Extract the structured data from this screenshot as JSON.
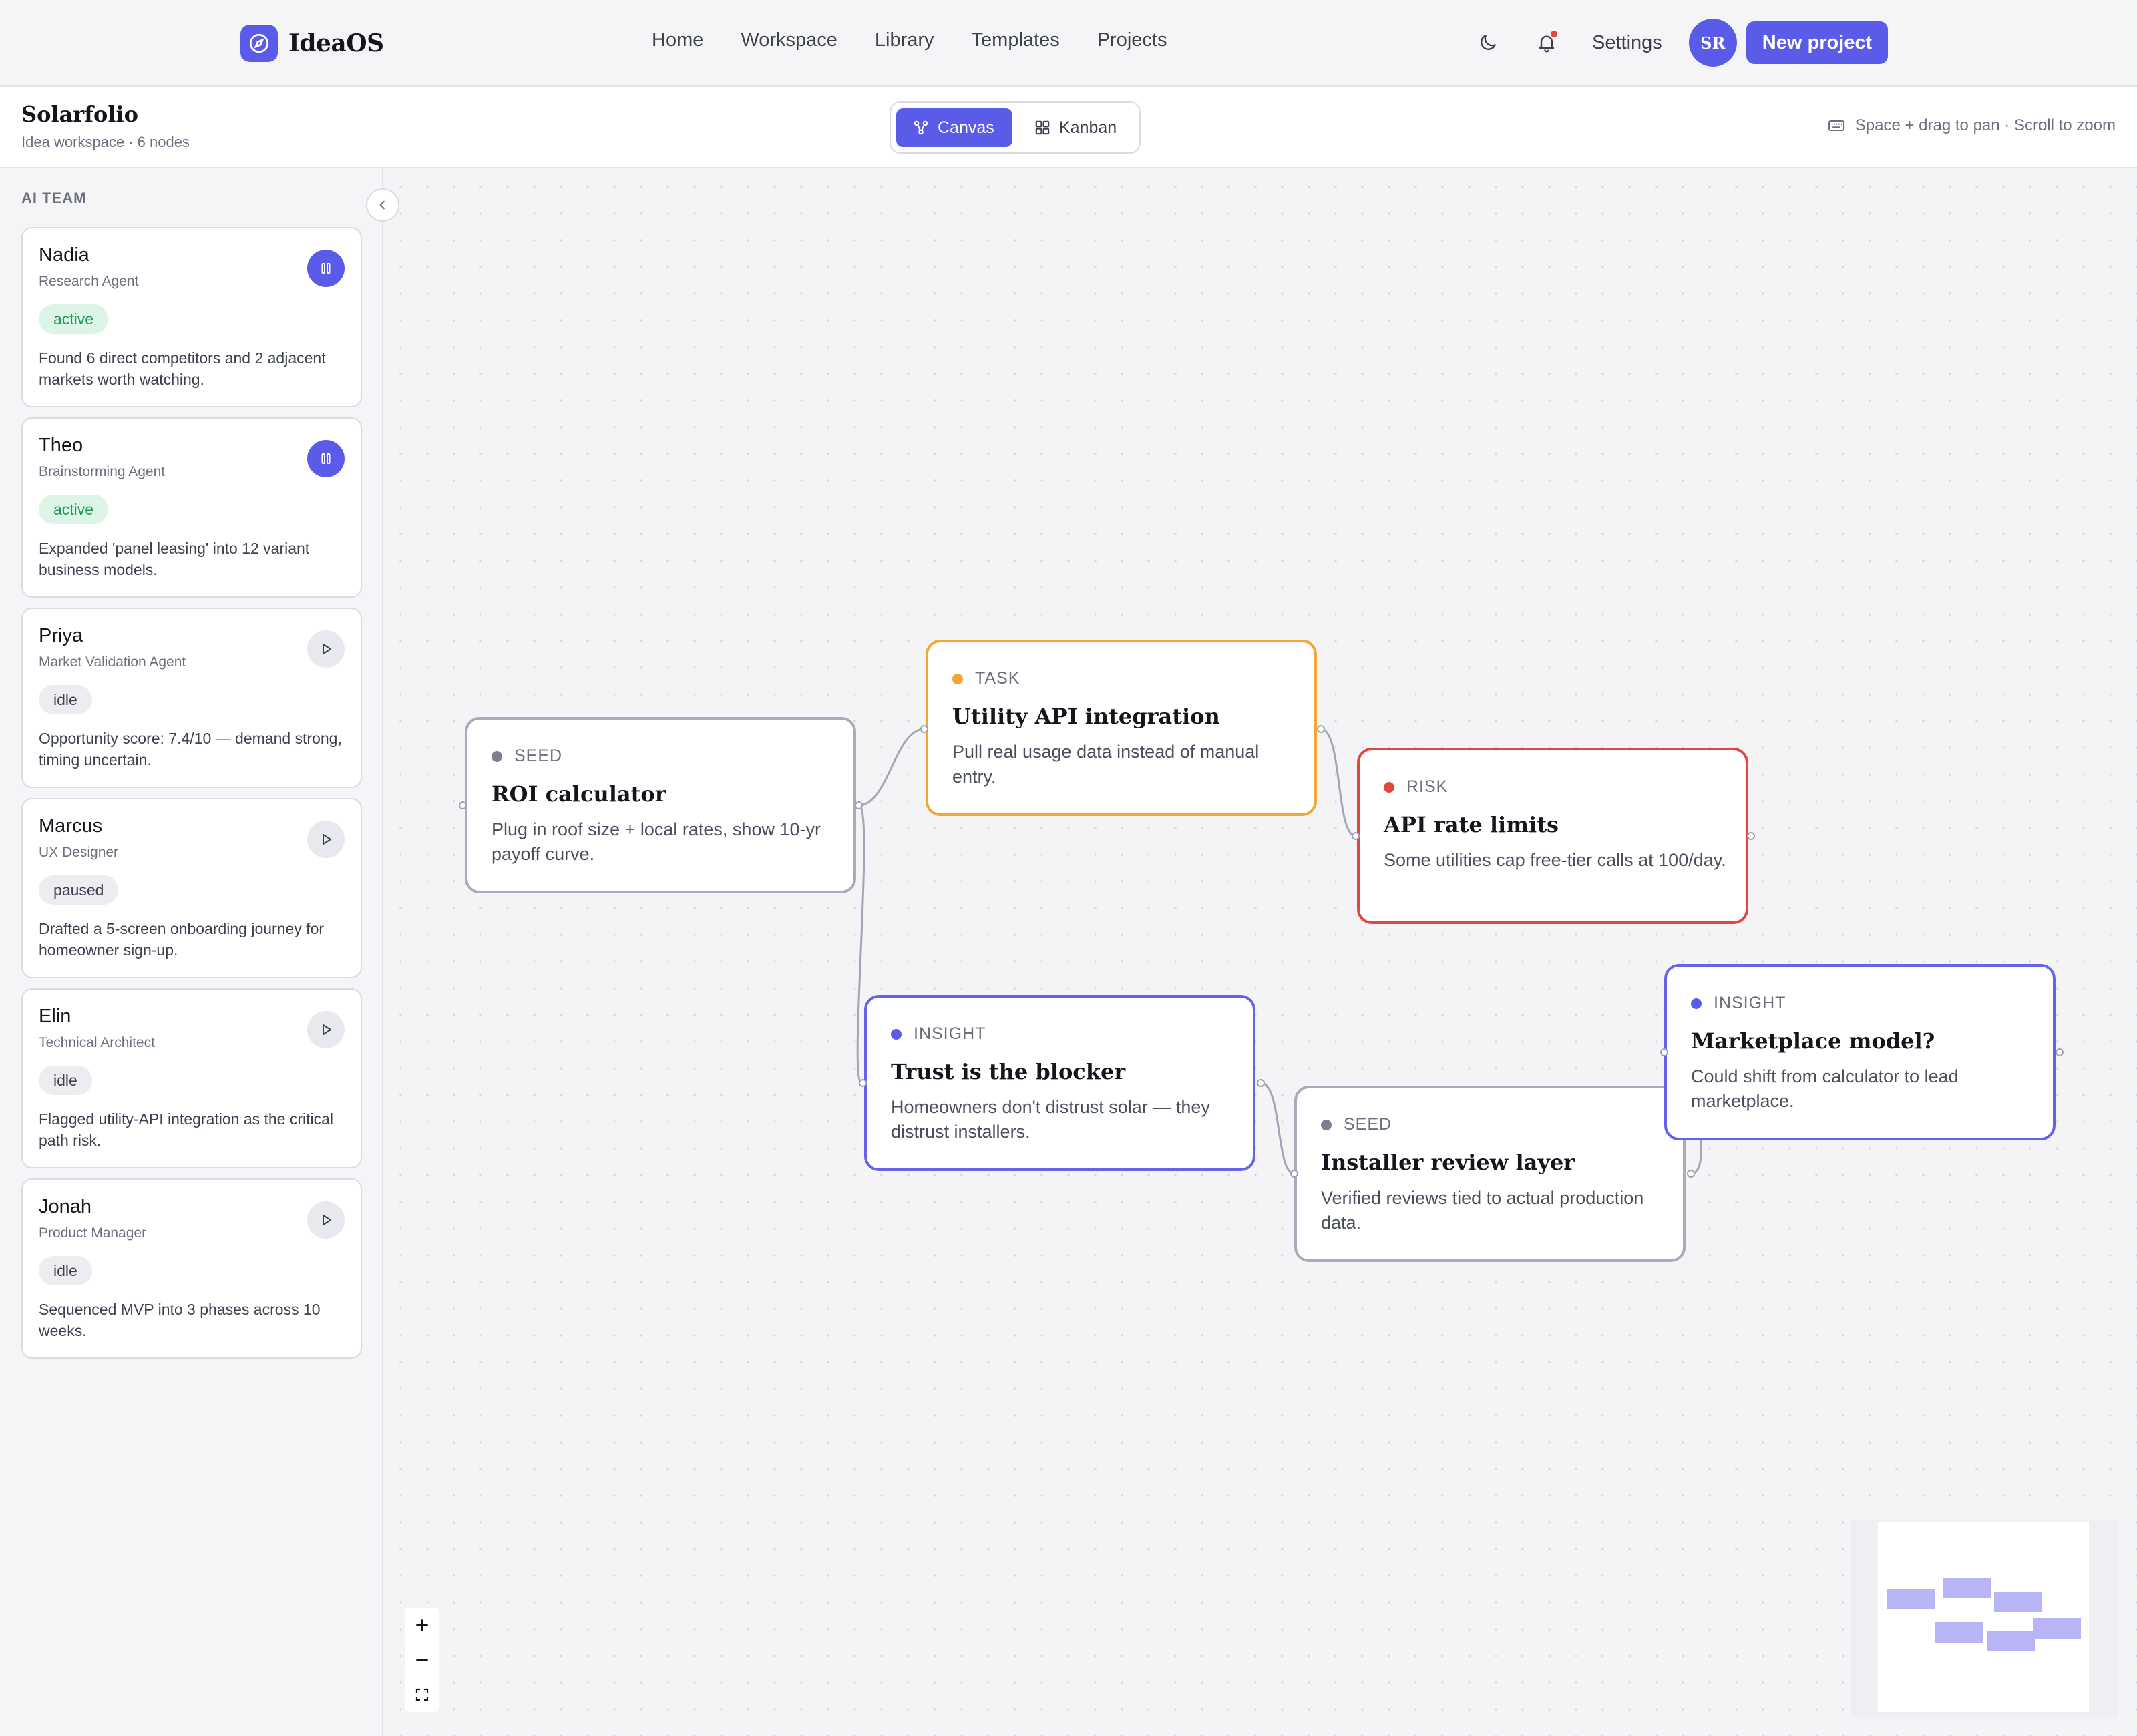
{
  "app": {
    "name": "IdeaOS"
  },
  "nav": {
    "links": [
      "Home",
      "Workspace",
      "Library",
      "Templates",
      "Projects"
    ],
    "settings_label": "Settings",
    "avatar_initials": "SR",
    "new_project_label": "New project",
    "notification_indicator": true
  },
  "workspace": {
    "title": "Solarfolio",
    "subtitle": "Idea workspace · 6 nodes",
    "views": [
      {
        "label": "Canvas",
        "icon": "nodes-icon",
        "active": true
      },
      {
        "label": "Kanban",
        "icon": "grid-icon",
        "active": false
      }
    ],
    "hint": "Space + drag to pan · Scroll to zoom"
  },
  "sidebar": {
    "title": "AI TEAM",
    "agents": [
      {
        "name": "Nadia",
        "role": "Research Agent",
        "status": "active",
        "action": "pause",
        "note": "Found 6 direct competitors and 2 adjacent markets worth watching."
      },
      {
        "name": "Theo",
        "role": "Brainstorming Agent",
        "status": "active",
        "action": "pause",
        "note": "Expanded 'panel leasing' into 12 variant business models."
      },
      {
        "name": "Priya",
        "role": "Market Validation Agent",
        "status": "idle",
        "action": "play",
        "note": "Opportunity score: 7.4/10 — demand strong, timing uncertain."
      },
      {
        "name": "Marcus",
        "role": "UX Designer",
        "status": "paused",
        "action": "play",
        "note": "Drafted a 5-screen onboarding journey for homeowner sign-up."
      },
      {
        "name": "Elin",
        "role": "Technical Architect",
        "status": "idle",
        "action": "play",
        "note": "Flagged utility-API integration as the critical path risk."
      },
      {
        "name": "Jonah",
        "role": "Product Manager",
        "status": "idle",
        "action": "play",
        "note": "Sequenced MVP into 3 phases across 10 weeks."
      }
    ]
  },
  "canvas": {
    "nodes": [
      {
        "type": "SEED",
        "kind": "seed",
        "title": "ROI calculator",
        "desc": "Plug in roof size + local rates, show 10-yr payoff curve."
      },
      {
        "type": "TASK",
        "kind": "task",
        "title": "Utility API integration",
        "desc": "Pull real usage data instead of manual entry."
      },
      {
        "type": "RISK",
        "kind": "risk",
        "title": "API rate limits",
        "desc": "Some utilities cap free-tier calls at 100/day."
      },
      {
        "type": "INSIGHT",
        "kind": "insight",
        "title": "Trust is the blocker",
        "desc": "Homeowners don't distrust solar — they distrust installers."
      },
      {
        "type": "SEED",
        "kind": "seed",
        "title": "Installer review layer",
        "desc": "Verified reviews tied to actual production data."
      },
      {
        "type": "INSIGHT",
        "kind": "insight",
        "title": "Marketplace model?",
        "desc": "Could shift from calculator to lead marketplace."
      }
    ]
  },
  "colors": {
    "accent": "#5b5bea",
    "seed": "#a8abbb",
    "task": "#f2a735",
    "risk": "#e2463c",
    "insight": "#6563ea",
    "seed_dot": "#7a7f90",
    "task_dot": "#f2a735",
    "risk_dot": "#e2463c",
    "insight_dot": "#5b5bea"
  }
}
